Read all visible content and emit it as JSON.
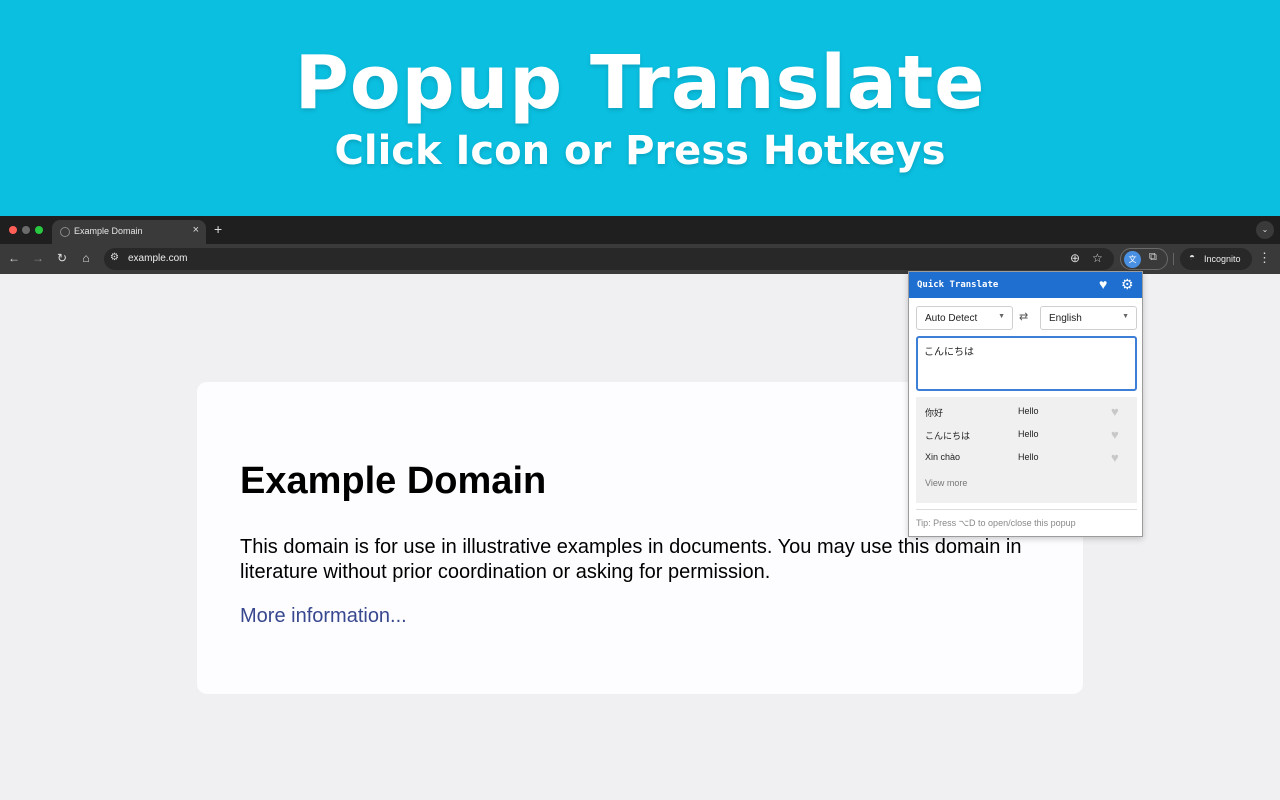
{
  "banner": {
    "title": "Popup Translate",
    "subtitle": "Click Icon or Press Hotkeys"
  },
  "browser": {
    "tab_title": "Example Domain",
    "tab_close": "×",
    "new_tab": "+",
    "tab_dropdown": "⌄",
    "url": "example.com",
    "incognito_label": "Incognito"
  },
  "page": {
    "heading": "Example Domain",
    "body": "This domain is for use in illustrative examples in documents. You may use this domain in literature without prior coordination or asking for permission.",
    "link": "More information..."
  },
  "popup": {
    "title": "Quick Translate",
    "source_language": "Auto Detect",
    "target_language": "English",
    "input_text": "こんにちは",
    "history": [
      {
        "source": "你好",
        "target": "Hello"
      },
      {
        "source": "こんにちは",
        "target": "Hello"
      },
      {
        "source": "Xin chào",
        "target": "Hello"
      }
    ],
    "view_more": "View more",
    "tip": "Tip: Press ⌥D to open/close this popup"
  },
  "colors": {
    "banner_bg": "#0bbfe0",
    "popup_header": "#1f6fd1",
    "link": "#38488f"
  }
}
